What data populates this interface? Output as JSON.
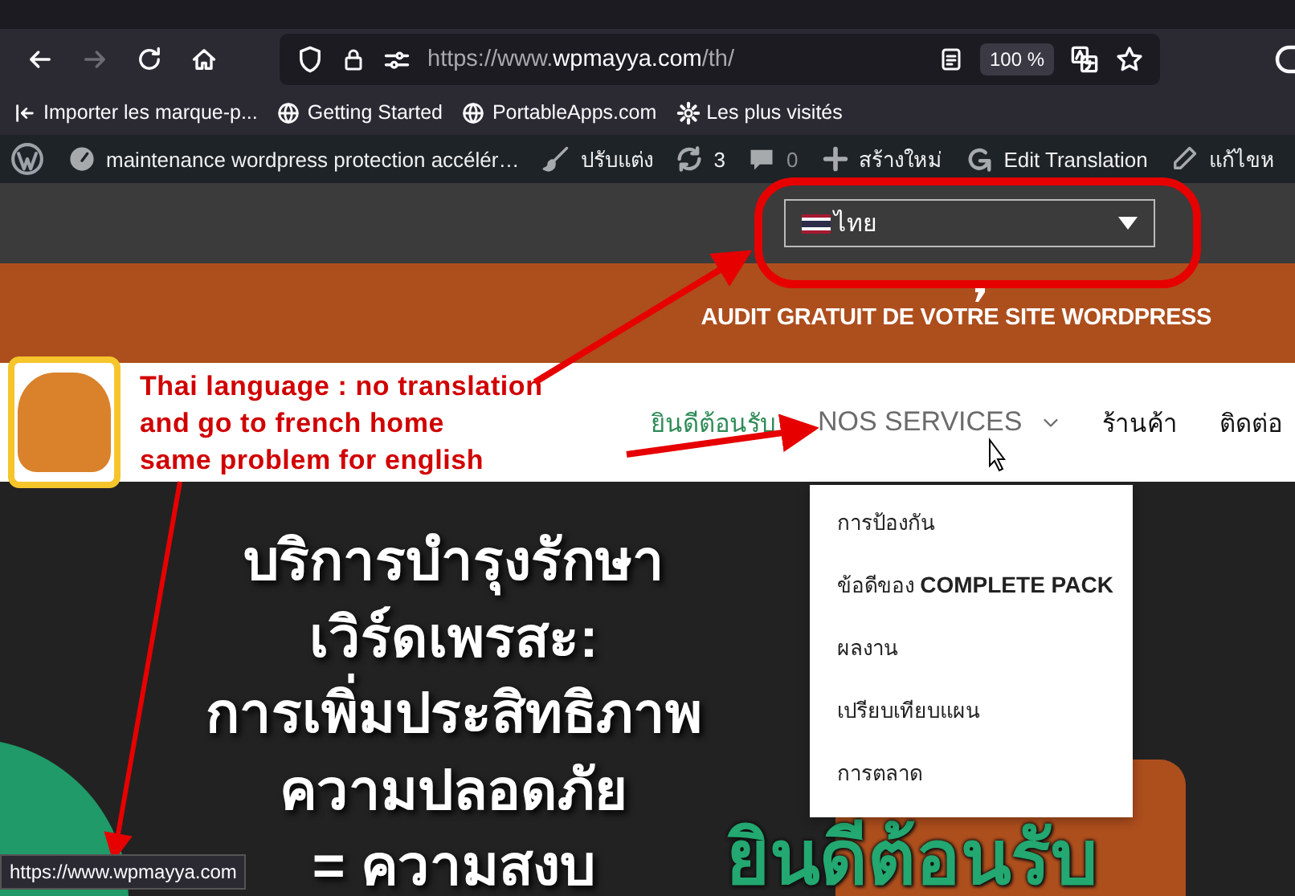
{
  "browser": {
    "nav_buttons": [
      {
        "kind": "back",
        "disabled": false
      },
      {
        "kind": "forward",
        "disabled": true
      },
      {
        "kind": "reload",
        "disabled": false
      },
      {
        "kind": "home",
        "disabled": false
      }
    ],
    "url": {
      "prefix": "https://www.",
      "domain": "wpmayya.com",
      "path": "/th/"
    },
    "zoom": "100 %",
    "bookmarks": [
      {
        "kind": "import",
        "label": "Importer les marque-p..."
      },
      {
        "kind": "globe",
        "label": "Getting Started"
      },
      {
        "kind": "globe",
        "label": "PortableApps.com"
      },
      {
        "kind": "gear",
        "label": "Les plus visités"
      }
    ]
  },
  "admin_bar": [
    {
      "kind": "wp"
    },
    {
      "kind": "gauge",
      "label": "maintenance wordpress protection accélér…"
    },
    {
      "kind": "brush",
      "label": "ปรับแต่ง"
    },
    {
      "kind": "sync",
      "label": "3"
    },
    {
      "kind": "comment",
      "label": "0"
    },
    {
      "kind": "plus",
      "label": "สร้างใหม่"
    },
    {
      "kind": "translate",
      "label": "Edit Translation"
    },
    {
      "kind": "pencil",
      "label": "แก้ไขห"
    }
  ],
  "language_select": {
    "value": "ไทย"
  },
  "banner": {
    "text": "AUDIT GRATUIT DE VOTRE SITE WORDPRESS"
  },
  "header": {
    "nav": [
      {
        "label": "ยินดีต้อนรับ",
        "selected": true,
        "hovered": false,
        "submenu": false
      },
      {
        "label": "NOS SERVICES",
        "selected": false,
        "hovered": true,
        "submenu": true
      },
      {
        "label": "ร้านค้า",
        "selected": false,
        "hovered": false,
        "submenu": false
      },
      {
        "label": "ติดต่อ",
        "selected": false,
        "hovered": false,
        "submenu": false
      }
    ]
  },
  "annotation": {
    "lines": [
      "Thai language : no translation",
      "and go to french home",
      "same problem for english"
    ]
  },
  "dropdown": {
    "items": [
      "การป้องกัน",
      "ข้อดีของ **COMPLETE PACK**",
      "ผลงาน",
      "เปรียบเทียบแผน",
      "การตลาด"
    ]
  },
  "hero": {
    "headline": [
      "บริการบำรุงรักษา",
      "เวิร์ดเพรสะ:",
      "การเพิ่มประสิทธิภาพ",
      "ความปลอดภัย",
      "= ความสงบ"
    ],
    "welcome": "ยินดีต้อนรับ"
  },
  "status_url": "https://www.wpmayya.com"
}
